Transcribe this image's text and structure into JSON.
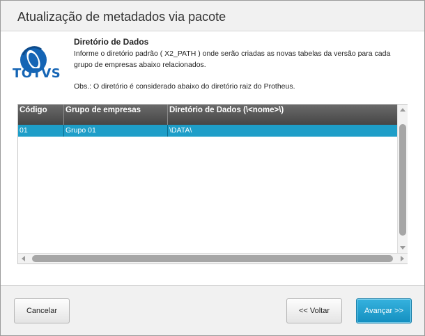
{
  "window": {
    "title": "Atualização de metadados via pacote"
  },
  "logo": {
    "text": "TOTVS",
    "colors": {
      "brand": "#1565b5"
    }
  },
  "info": {
    "heading": "Diretório de Dados",
    "description": "Informe o diretório padrão ( X2_PATH ) onde serão criadas as novas tabelas da versão para cada grupo de empresas abaixo relacionados.",
    "obs": "Obs.: O diretório é considerado abaixo do diretório raiz do Protheus."
  },
  "grid": {
    "columns": [
      "Código",
      "Grupo de empresas",
      "Diretório de Dados (\\<nome>\\)"
    ],
    "rows": [
      {
        "codigo": "01",
        "grupo": "Grupo 01",
        "diretorio": "\\DATA\\"
      }
    ],
    "colors": {
      "header": "#555555",
      "selected_row": "#1e9ec8"
    }
  },
  "footer": {
    "cancel_label": "Cancelar",
    "back_label": "<< Voltar",
    "next_label": "Avançar >>",
    "colors": {
      "primary": "#1e9ec8"
    }
  }
}
